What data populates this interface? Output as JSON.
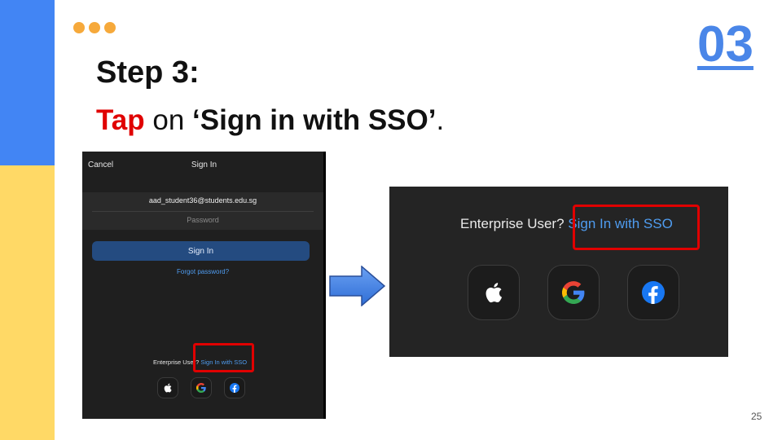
{
  "slide": {
    "step_title": "Step 3:",
    "instruction_action": "Tap",
    "instruction_mid": " on ",
    "instruction_target": "‘Sign in with SSO’",
    "instruction_end": ".",
    "step_number": "03",
    "page_number": "25"
  },
  "colors": {
    "accent_blue": "#4285F4",
    "accent_yellow": "#FFD966",
    "dot_orange": "#F6A93B",
    "highlight_red": "#E00000",
    "link_blue": "#4f9cf0"
  },
  "phone_screen": {
    "cancel": "Cancel",
    "title": "Sign In",
    "email_value": "aad_student36@students.edu.sg",
    "password_placeholder": "Password",
    "signin_button": "Sign In",
    "forgot_link": "Forgot password?",
    "enterprise_prefix": "Enterprise User? ",
    "sso_link": "Sign In with SSO",
    "social_icons": [
      "apple-icon",
      "google-icon",
      "facebook-icon"
    ]
  },
  "zoom_view": {
    "enterprise_prefix": "Enterprise User? ",
    "sso_link": "Sign In with SSO",
    "social_icons": [
      "apple-icon",
      "google-icon",
      "facebook-icon"
    ]
  }
}
